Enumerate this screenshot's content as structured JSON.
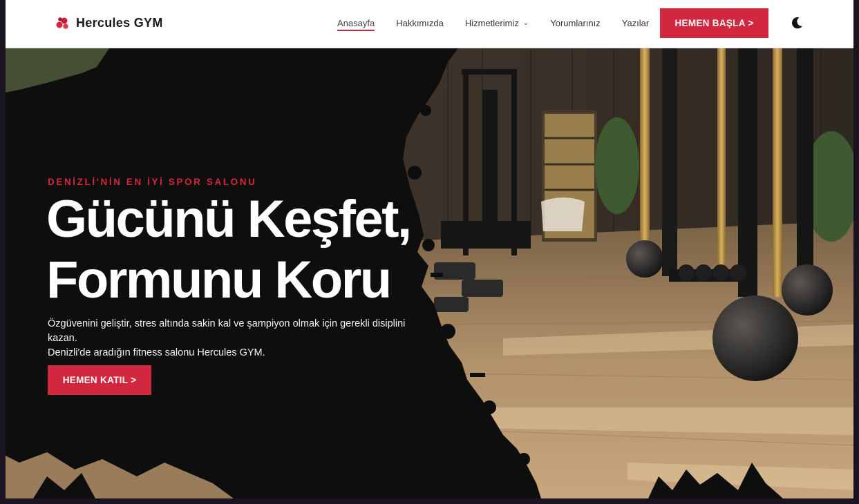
{
  "brand": {
    "name": "Hercules GYM",
    "accent": "#d1283f"
  },
  "nav": {
    "items": [
      {
        "label": "Anasayfa",
        "active": true
      },
      {
        "label": "Hakkımızda"
      },
      {
        "label": "Hizmetlerimiz",
        "has_dropdown": true
      },
      {
        "label": "Yorumlarınız"
      },
      {
        "label": "Yazılar"
      }
    ],
    "cta_label": "HEMEN BAŞLA >",
    "theme_toggle_icon": "moon-icon"
  },
  "hero": {
    "eyebrow": "DENİZLİ'NİN EN İYİ SPOR SALONU",
    "headline_line1": "Gücünü Keşfet,",
    "headline_line2": "Formunu Koru",
    "description_line1": "Özgüvenini geliştir, stres altında sakin kal ve şampiyon olmak için gerekli disiplini kazan.",
    "description_line2": "Denizli'de aradığın fitness salonu Hercules GYM.",
    "cta_label": "HEMEN KATIL >"
  }
}
